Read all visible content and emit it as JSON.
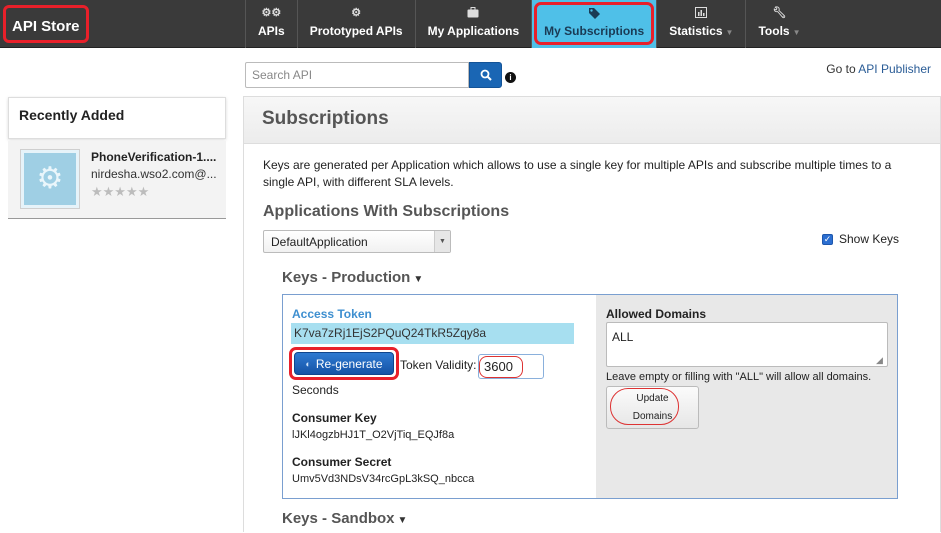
{
  "topbar": {
    "brand": "API Store",
    "nav": [
      {
        "label": "APIs",
        "icon": "gears-icon"
      },
      {
        "label": "Prototyped APIs",
        "icon": "gear-icon"
      },
      {
        "label": "My Applications",
        "icon": "briefcase-icon"
      },
      {
        "label": "My Subscriptions",
        "icon": "tags-icon",
        "active": true
      },
      {
        "label": "Statistics",
        "icon": "bar-chart-icon",
        "dropdown": true
      },
      {
        "label": "Tools",
        "icon": "wrench-icon",
        "dropdown": true
      }
    ],
    "active_color": "#4fc0e8",
    "highlight_color": "#e8202a"
  },
  "search": {
    "placeholder": "Search API"
  },
  "goto": {
    "prefix": "Go to",
    "link": "API Publisher"
  },
  "sidebar": {
    "title": "Recently Added",
    "items": [
      {
        "name": "PhoneVerification-1....",
        "owner": "nirdesha.wso2.com@...",
        "rating": 0,
        "stars": "★★★★★"
      }
    ]
  },
  "main": {
    "title": "Subscriptions",
    "description": "Keys are generated per Application which allows to use a single key for multiple APIs and subscribe multiple times to a single API, with different SLA levels.",
    "apps_title": "Applications With Subscriptions",
    "selected_app": "DefaultApplication",
    "show_keys_label": "Show Keys",
    "show_keys_checked": true,
    "production": {
      "title": "Keys - Production",
      "access_token_label": "Access Token",
      "access_token": "K7va7zRj1EjS2PQuQ24TkR5Zqy8a",
      "regenerate_label": "Re-generate",
      "token_validity_label": "Token Validity:",
      "token_validity_value": "3600",
      "token_validity_unit": "Seconds",
      "consumer_key_label": "Consumer Key",
      "consumer_key": "lJKl4ogzbHJ1T_O2VjTiq_EQJf8a",
      "consumer_secret_label": "Consumer Secret",
      "consumer_secret": "Umv5Vd3NDsV34rcGpL3kSQ_nbcca",
      "allowed_domains_label": "Allowed Domains",
      "allowed_domains_value": "ALL",
      "allowed_domains_hint": "Leave empty or filling with \"ALL\" will allow all domains.",
      "update_line1": "Update",
      "update_line2": "Domains"
    },
    "sandbox": {
      "title": "Keys - Sandbox"
    }
  }
}
